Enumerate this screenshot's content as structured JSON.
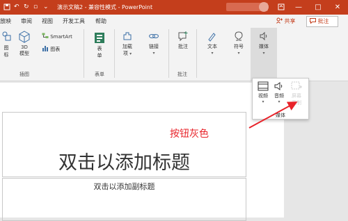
{
  "titlebar": {
    "qat_save": "",
    "qat_undo": "↶",
    "qat_redo": "↻",
    "qat_start": "▫",
    "qat_more": "⌄",
    "title": "演示文稿2  -  兼容性模式  -  PowerPoint",
    "account_text": "",
    "min": "—",
    "restore": "□",
    "close": "✕"
  },
  "tabs": [
    {
      "label": "放映"
    },
    {
      "label": "审阅"
    },
    {
      "label": "视图"
    },
    {
      "label": "开发工具"
    },
    {
      "label": "帮助"
    }
  ],
  "share_label": "共享",
  "comments_label": "批注",
  "ribbon": {
    "illustrations": {
      "group_label": "插图",
      "icons_label_1": "图",
      "icons_label_2": "标",
      "model_label_1": "3D",
      "model_label_2": "模型",
      "smartart_label": "SmartArt",
      "chart_label": "图表"
    },
    "forms": {
      "group_label": "表单",
      "form_label_1": "表",
      "form_label_2": "单"
    },
    "addins": {
      "label_1": "加载",
      "label_2": "项"
    },
    "links": {
      "label": "链接"
    },
    "comments": {
      "group_label": "批注",
      "label": "批注"
    },
    "text": {
      "label": "文本"
    },
    "symbols": {
      "label": "符号"
    },
    "media": {
      "label": "媒体"
    }
  },
  "media_popup": {
    "video_label": "视频",
    "audio_label": "音频",
    "screen_rec_label_1": "屏幕",
    "screen_rec_label_2": "录制",
    "group_label": "媒体"
  },
  "slide": {
    "title_placeholder": "双击以添加标题",
    "subtitle_placeholder": "双击以添加副标题"
  },
  "annotation": {
    "text": "按钮灰色",
    "color": "#e8232a"
  },
  "colors": {
    "accent": "#c43e1c",
    "ribbon_bg": "#f3f3f3"
  }
}
